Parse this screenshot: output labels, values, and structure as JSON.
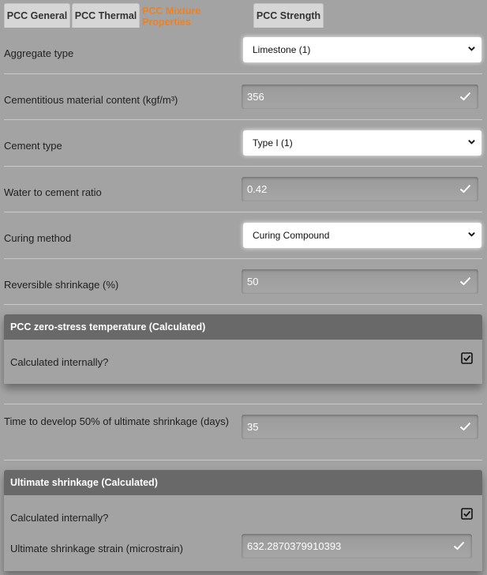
{
  "tabs": [
    {
      "label": "PCC General",
      "active": false
    },
    {
      "label": "PCC Thermal",
      "active": false
    },
    {
      "label": "PCC Mixture Properties",
      "active": true
    },
    {
      "label": "PCC Strength",
      "active": false
    }
  ],
  "form": {
    "aggregate_type": {
      "label": "Aggregate type",
      "value": "Limestone (1)"
    },
    "cementitious_content": {
      "label": "Cementitious material content (kgf/m³)",
      "value": "356"
    },
    "cement_type": {
      "label": "Cement type",
      "value": "Type I (1)"
    },
    "water_cement_ratio": {
      "label": "Water to cement ratio",
      "value": "0.42"
    },
    "curing_method": {
      "label": "Curing method",
      "value": "Curing Compound"
    },
    "reversible_shrinkage": {
      "label": "Reversible shrinkage (%)",
      "value": "50"
    },
    "zero_stress": {
      "title": "PCC zero-stress temperature (Calculated)",
      "calc_label": "Calculated internally?",
      "calc_checked": true
    },
    "time_50": {
      "label": "Time to develop 50% of ultimate shrinkage (days)",
      "value": "35"
    },
    "ultimate": {
      "title": "Ultimate shrinkage (Calculated)",
      "calc_label": "Calculated internally?",
      "calc_checked": true,
      "strain_label": "Ultimate shrinkage strain (microstrain)",
      "strain_value": "632.2870379910393"
    }
  },
  "colors": {
    "accent": "#ee8220",
    "header": "#696969",
    "background": "#a3a3a3"
  },
  "icons": {
    "field_valid": "check-icon",
    "select": "chevron-down-icon",
    "checkbox": "checkbox-checked-icon"
  }
}
